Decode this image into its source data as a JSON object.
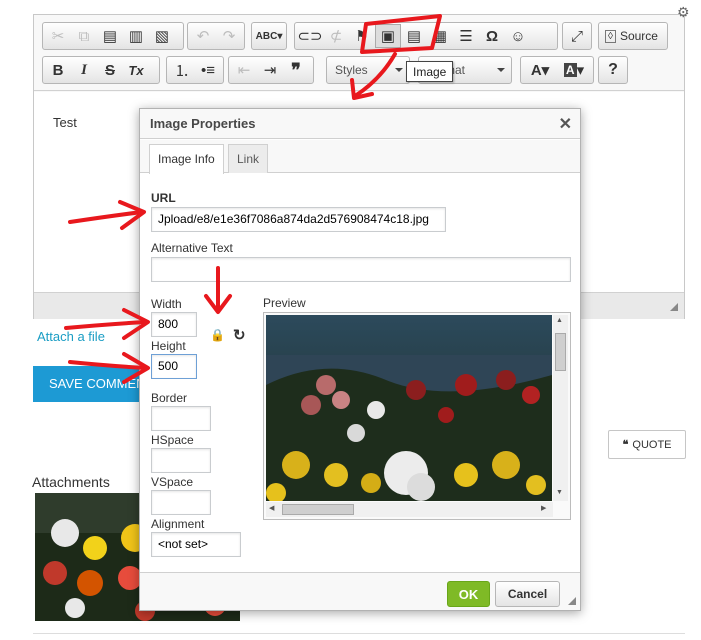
{
  "toolbar": {
    "row1": [
      {
        "name": "cut-icon",
        "glyph": "✂"
      },
      {
        "name": "copy-icon",
        "glyph": "⎘"
      },
      {
        "name": "paste-icon",
        "glyph": "📋"
      },
      {
        "name": "paste-text-icon",
        "glyph": "📋"
      },
      {
        "name": "paste-word-icon",
        "glyph": "📋"
      },
      {
        "name": "undo-icon",
        "glyph": "↶"
      },
      {
        "name": "redo-icon",
        "glyph": "↷"
      },
      {
        "name": "spellcheck-icon",
        "glyph": "ABC"
      },
      {
        "name": "link-icon",
        "glyph": "🔗"
      },
      {
        "name": "unlink-icon",
        "glyph": "⛓"
      },
      {
        "name": "anchor-icon",
        "glyph": "⚑"
      },
      {
        "name": "image-icon",
        "glyph": "🖼"
      },
      {
        "name": "flash-icon",
        "glyph": "▤"
      },
      {
        "name": "table-icon",
        "glyph": "▦"
      },
      {
        "name": "horizontal-rule-icon",
        "glyph": "☰"
      },
      {
        "name": "special-char-icon",
        "glyph": "Ω"
      },
      {
        "name": "smiley-icon",
        "glyph": "☺"
      },
      {
        "name": "maximize-icon",
        "glyph": "⤢"
      }
    ],
    "source_label": "Source",
    "styles_label": "Styles",
    "format_label": "Format",
    "bold_label": "B",
    "italic_label": "I",
    "strike_label": "S",
    "clear_format_label": "Tx",
    "quote_glyph": "❞",
    "help_label": "?",
    "image_tooltip": "Image"
  },
  "editor": {
    "content_text": "Test"
  },
  "dialog": {
    "title": "Image Properties",
    "close_glyph": "✕",
    "tabs": [
      "Image Info",
      "Link"
    ],
    "url_label": "URL",
    "url_value": "Jpload/e8/e1e36f7086a874da2d576908474c18.jpg",
    "alt_label": "Alternative Text",
    "alt_value": "",
    "width_label": "Width",
    "width_value": "800",
    "height_label": "Height",
    "height_value": "500",
    "border_label": "Border",
    "border_value": "",
    "hspace_label": "HSpace",
    "hspace_value": "",
    "vspace_label": "VSpace",
    "vspace_value": "",
    "alignment_label": "Alignment",
    "alignment_value": "<not set>",
    "preview_label": "Preview",
    "ok_label": "OK",
    "cancel_label": "Cancel"
  },
  "page": {
    "attach_link": "Attach a file",
    "save_button": "SAVE COMMENT",
    "quote_button": "QUOTE",
    "attachments_title": "Attachments"
  },
  "colors": {
    "accent": "#1d9ad4",
    "ok_green": "#7fba26",
    "annotation_red": "#e8181d"
  }
}
